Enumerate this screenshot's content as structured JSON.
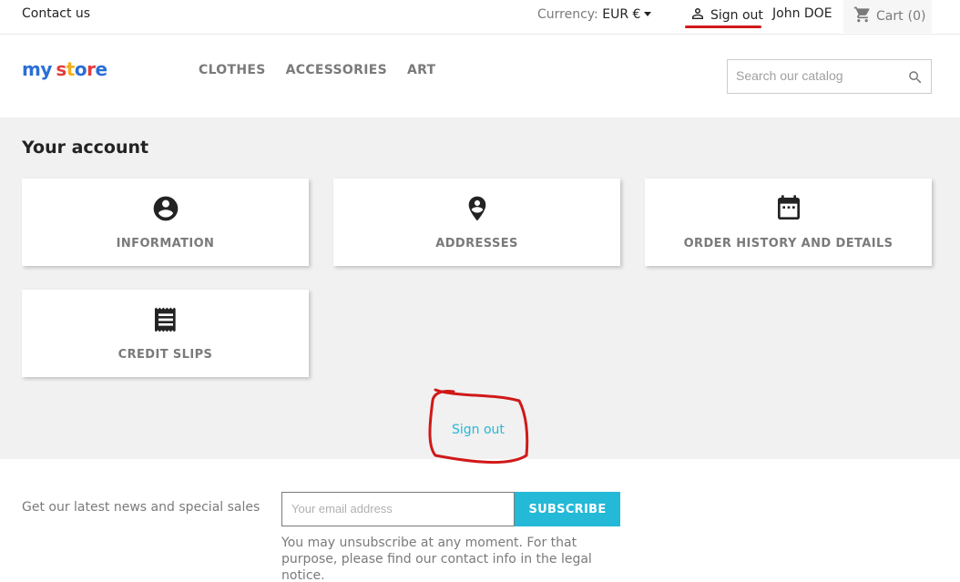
{
  "topbar": {
    "contact_label": "Contact us",
    "currency_label": "Currency:",
    "currency_value": "EUR €",
    "sign_out_label": "Sign out",
    "user_name": "John DOE",
    "cart_label": "Cart",
    "cart_count": "(0)"
  },
  "header": {
    "logo": {
      "word1": "my",
      "word2": "store"
    },
    "nav": [
      {
        "label": "CLOTHES"
      },
      {
        "label": "ACCESSORIES"
      },
      {
        "label": "ART"
      }
    ],
    "search_placeholder": "Search our catalog"
  },
  "account": {
    "title": "Your account",
    "cards": [
      {
        "label": "INFORMATION",
        "icon": "account-circle-icon"
      },
      {
        "label": "ADDRESSES",
        "icon": "location-pin-icon"
      },
      {
        "label": "ORDER HISTORY AND DETAILS",
        "icon": "calendar-icon"
      },
      {
        "label": "CREDIT SLIPS",
        "icon": "receipt-icon"
      }
    ],
    "sign_out_link": "Sign out"
  },
  "newsletter": {
    "text": "Get our latest news and special sales",
    "email_placeholder": "Your email address",
    "subscribe_label": "SUBSCRIBE",
    "legal_text": "You may unsubscribe at any moment. For that purpose, please find our contact info in the legal notice."
  },
  "colors": {
    "accent": "#24b9d7",
    "annotation": "#d01919",
    "text_muted": "#7a7a7a",
    "background_main": "#f1f1f1"
  }
}
